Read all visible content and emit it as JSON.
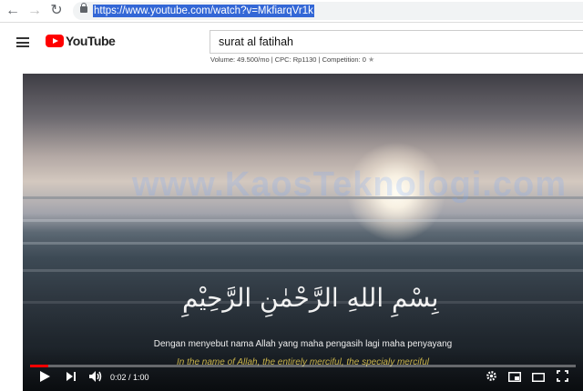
{
  "browser": {
    "back_icon": "←",
    "forward_icon": "→",
    "reload_icon": "↻",
    "url": "https://www.youtube.com/watch?v=MkfiarqVr1k"
  },
  "header": {
    "logo_text": "YouTube",
    "search_value": "surat al fatihah",
    "meta": "Volume: 49.500/mo | CPC: Rp1130 | Competition: 0"
  },
  "video": {
    "watermark": "www.KaosTeknologi.com",
    "arabic": "بِسْمِ اللهِ الرَّحْمٰنِ الرَّحِيْمِ",
    "caption_indonesian": "Dengan menyebut nama Allah yang maha pengasih lagi maha penyayang",
    "caption_english": "In the name of Allah, the entirely merciful, the specialy merciful",
    "time": "0:02 / 1:00",
    "progress_fraction": 0.033
  }
}
